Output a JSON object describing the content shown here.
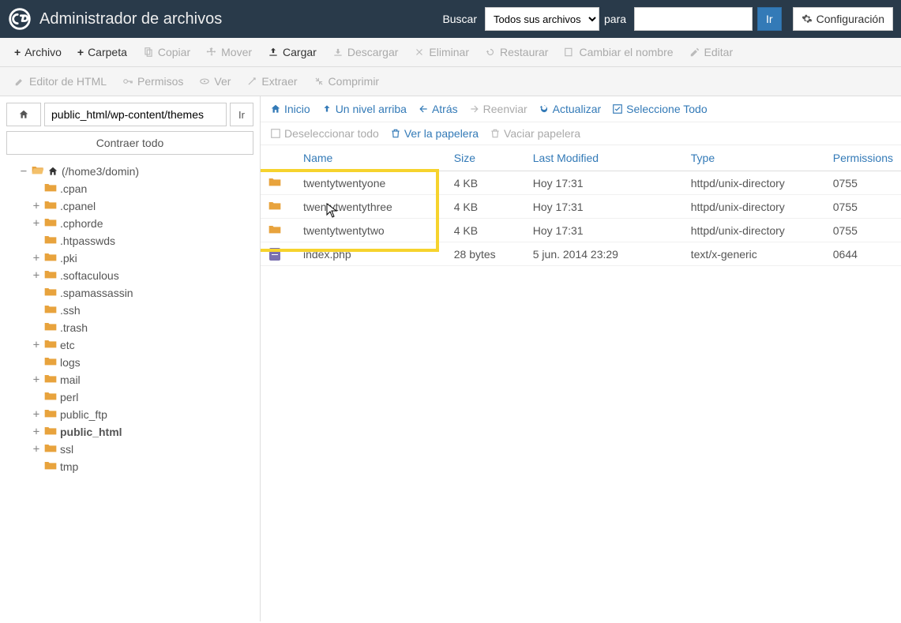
{
  "header": {
    "title": "Administrador de archivos",
    "search_label": "Buscar",
    "search_scope": "Todos sus archivos",
    "for_label": "para",
    "search_value": "",
    "go": "Ir",
    "settings": "Configuración"
  },
  "toolbar": {
    "file": "Archivo",
    "folder": "Carpeta",
    "copy": "Copiar",
    "move": "Mover",
    "upload": "Cargar",
    "download": "Descargar",
    "delete": "Eliminar",
    "restore": "Restaurar",
    "rename": "Cambiar el nombre",
    "edit": "Editar",
    "html_editor": "Editor de HTML",
    "permissions": "Permisos",
    "view": "Ver",
    "extract": "Extraer",
    "compress": "Comprimir"
  },
  "sidebar": {
    "path": "public_html/wp-content/themes",
    "go": "Ir",
    "collapse_all": "Contraer todo",
    "root": "(/home3/domin)",
    "items": [
      {
        "name": ".cpan",
        "expandable": false
      },
      {
        "name": ".cpanel",
        "expandable": true
      },
      {
        "name": ".cphorde",
        "expandable": true
      },
      {
        "name": ".htpasswds",
        "expandable": false
      },
      {
        "name": ".pki",
        "expandable": true
      },
      {
        "name": ".softaculous",
        "expandable": true
      },
      {
        "name": ".spamassassin",
        "expandable": false
      },
      {
        "name": ".ssh",
        "expandable": false
      },
      {
        "name": ".trash",
        "expandable": false
      },
      {
        "name": "etc",
        "expandable": true
      },
      {
        "name": "logs",
        "expandable": false
      },
      {
        "name": "mail",
        "expandable": true
      },
      {
        "name": "perl",
        "expandable": false
      },
      {
        "name": "public_ftp",
        "expandable": true
      },
      {
        "name": "public_html",
        "expandable": true,
        "bold": true
      },
      {
        "name": "ssl",
        "expandable": true
      },
      {
        "name": "tmp",
        "expandable": false
      }
    ]
  },
  "contentbar": {
    "home": "Inicio",
    "up": "Un nivel arriba",
    "back": "Atrás",
    "forward": "Reenviar",
    "reload": "Actualizar",
    "select_all": "Seleccione Todo",
    "deselect_all": "Deseleccionar todo",
    "view_trash": "Ver la papelera",
    "empty_trash": "Vaciar papelera"
  },
  "columns": {
    "name": "Name",
    "size": "Size",
    "modified": "Last Modified",
    "type": "Type",
    "permissions": "Permissions"
  },
  "files": [
    {
      "icon": "folder",
      "name": "twentytwentyone",
      "size": "4 KB",
      "modified": "Hoy 17:31",
      "type": "httpd/unix-directory",
      "perm": "0755"
    },
    {
      "icon": "folder",
      "name": "twentytwentythree",
      "size": "4 KB",
      "modified": "Hoy 17:31",
      "type": "httpd/unix-directory",
      "perm": "0755"
    },
    {
      "icon": "folder",
      "name": "twentytwentytwo",
      "size": "4 KB",
      "modified": "Hoy 17:31",
      "type": "httpd/unix-directory",
      "perm": "0755"
    },
    {
      "icon": "file",
      "name": "index.php",
      "size": "28 bytes",
      "modified": "5 jun. 2014 23:29",
      "type": "text/x-generic",
      "perm": "0644"
    }
  ]
}
